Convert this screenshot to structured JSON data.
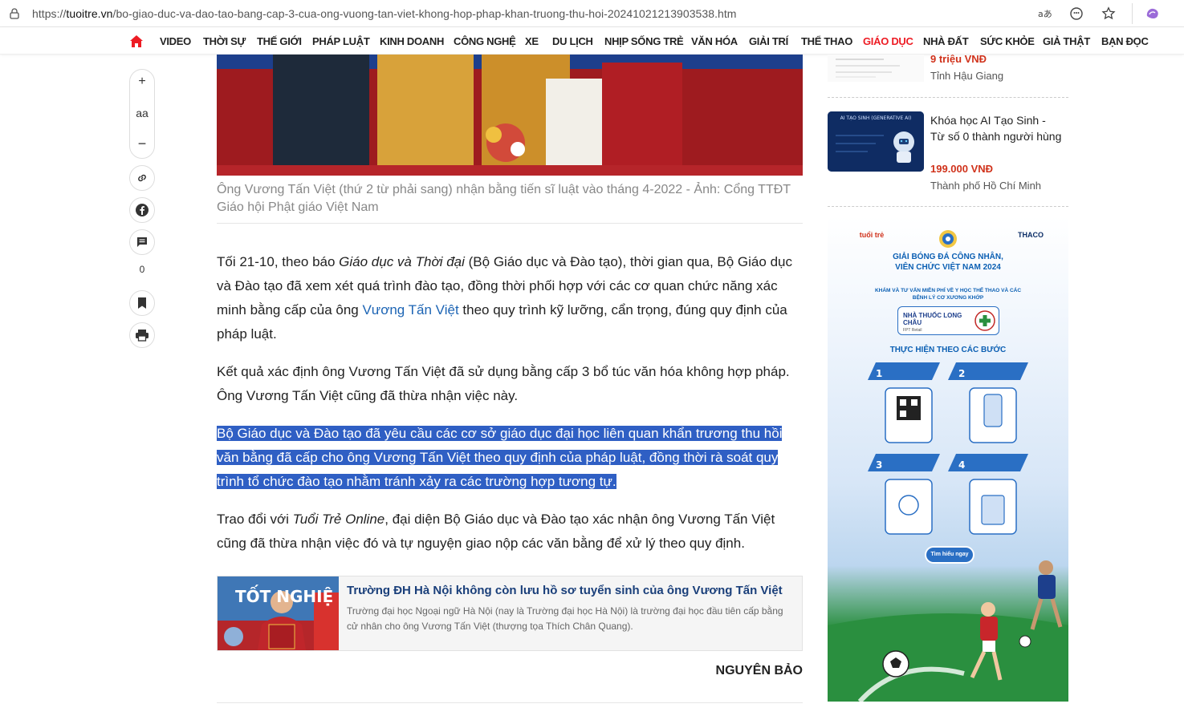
{
  "browser": {
    "url_scheme": "https://",
    "url_domain": "tuoitre.vn",
    "url_path": "/bo-giao-duc-va-dao-tao-bang-cap-3-cua-ong-vuong-tan-viet-khong-hop-phap-khan-truong-thu-hoi-20241021213903538.htm",
    "icons": [
      "lock-icon",
      "translate-icon",
      "emoji-icon",
      "star-icon",
      "copilot-icon"
    ]
  },
  "nav": {
    "items": [
      "VIDEO",
      "THỜI SỰ",
      "THẾ GIỚI",
      "PHÁP LUẬT",
      "KINH DOANH",
      "CÔNG NGHỆ",
      "XE",
      "DU LỊCH",
      "NHỊP SỐNG TRẺ",
      "VĂN HÓA",
      "GIẢI TRÍ",
      "THỂ THAO",
      "GIÁO DỤC",
      "NHÀ ĐẤT",
      "SỨC KHỎE",
      "GIẢ THẬT",
      "BẠN ĐỌC"
    ],
    "active": "GIÁO DỤC",
    "active_color": "#ed1c24"
  },
  "toolbar": {
    "font_label": "aa",
    "comment_count": "0"
  },
  "article": {
    "caption": "Ông Vương Tấn Việt (thứ 2 từ phải sang) nhận bằng tiến sĩ luật vào tháng 4-2022 - Ảnh: Cổng TTĐT Giáo hội Phật giáo Việt Nam",
    "p1_a": "Tối 21-10, theo báo ",
    "p1_i": "Giáo dục và Thời đại",
    "p1_b": " (Bộ Giáo dục và Đào tạo), thời gian qua, Bộ Giáo dục và Đào tạo đã xem xét quá trình đào tạo, đồng thời phối hợp với các cơ quan chức năng xác minh bằng cấp của ông ",
    "p1_link": "Vương Tấn Việt",
    "p1_c": " theo quy trình kỹ lưỡng, cẩn trọng, đúng quy định của pháp luật.",
    "p2": "Kết quả xác định ông Vương Tấn Việt đã sử dụng bằng cấp 3 bổ túc văn hóa không hợp pháp. Ông Vương Tấn Việt cũng đã thừa nhận việc này.",
    "p3": "Bộ Giáo dục và Đào tạo đã yêu cầu các cơ sở giáo dục đại học liên quan khẩn trương thu hồi văn bằng đã cấp cho ông Vương Tấn Việt theo quy định của pháp luật, đồng thời rà soát quy trình tổ chức đào tạo nhằm tránh xảy ra các trường hợp tương tự.",
    "p4_a": "Trao đổi với ",
    "p4_i": "Tuổi Trẻ Online",
    "p4_b": ", đại diện Bộ Giáo dục và Đào tạo xác nhận ông Vương Tấn Việt cũng đã thừa nhận việc đó và tự nguyện giao nộp các văn bằng để xử lý theo quy định.",
    "related_title": "Trường ĐH Hà Nội không còn lưu hồ sơ tuyển sinh của ông Vương Tấn Việt",
    "related_desc": "Trường đại học Ngoại ngữ Hà Nội (nay là Trường đại học Hà Nội) là trường đại học đầu tiên cấp bằng cử nhân cho ông Vương Tấn Việt (thượng tọa Thích Chân Quang).",
    "related_thumb_text": "TỐT NGHIỆ",
    "author": "NGUYÊN BẢO"
  },
  "sidebar": {
    "item1": {
      "price": "9 triệu VNĐ",
      "location": "Tỉnh Hậu Giang"
    },
    "item2": {
      "title": "Khóa học AI Tạo Sinh - Từ số 0 thành người hùng",
      "price": "199.000 VNĐ",
      "location": "Thành phố Hồ Chí Minh",
      "thumb_text": "AI TẠO SINH (GENERATIVE AI)"
    },
    "ad": {
      "title": "GIẢI BÓNG ĐÁ CÔNG NHÂN, VIÊN CHỨC VIỆT NAM 2024",
      "subtitle": "KHÁM VÀ TƯ VẤN MIỄN PHÍ VỀ Y HỌC THỂ THAO VÀ CÁC BỆNH LÝ CƠ XƯƠNG KHỚP",
      "brand": "NHÀ THUỐC LONG CHÂU",
      "brand_small": "FPT Retail",
      "steps_heading": "THỰC HIỆN THEO CÁC BƯỚC",
      "cta": "Tìm hiểu ngay",
      "logo_right": "THACO",
      "logo_left": "tuổi trẻ"
    }
  }
}
